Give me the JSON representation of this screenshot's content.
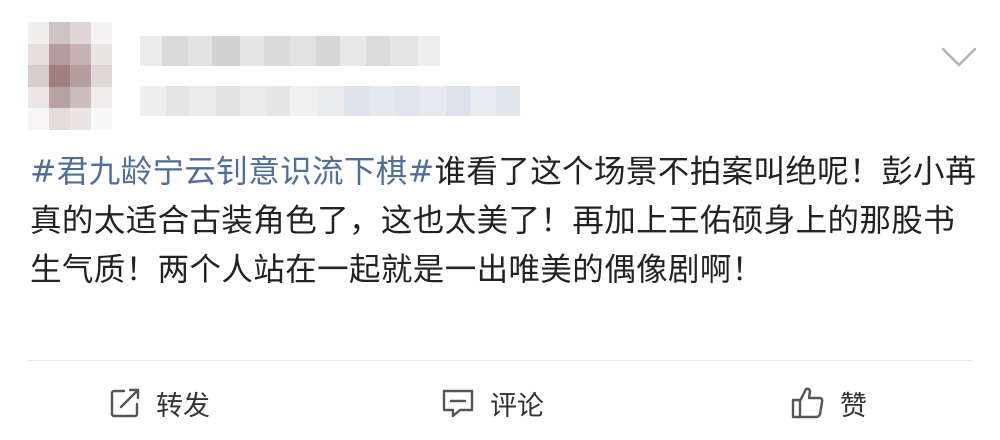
{
  "post": {
    "topic": "#君九龄宁云钊意识流下棋#",
    "text": "谁看了这个场景不拍案叫绝呢！彭小苒真的太适合古装角色了，这也太美了！再加上王佑硕身上的那股书生气质！两个人站在一起就是一出唯美的偶像剧啊！"
  },
  "actions": {
    "repost_label": "转发",
    "comment_label": "评论",
    "like_label": "赞"
  },
  "colors": {
    "topic": "#4f6e98",
    "text": "#222222",
    "divider": "#e8e8e8",
    "icon": "#555555"
  },
  "icons": {
    "more": "chevron-down-icon",
    "repost": "repost-icon",
    "comment": "comment-icon",
    "like": "thumbs-up-icon"
  }
}
